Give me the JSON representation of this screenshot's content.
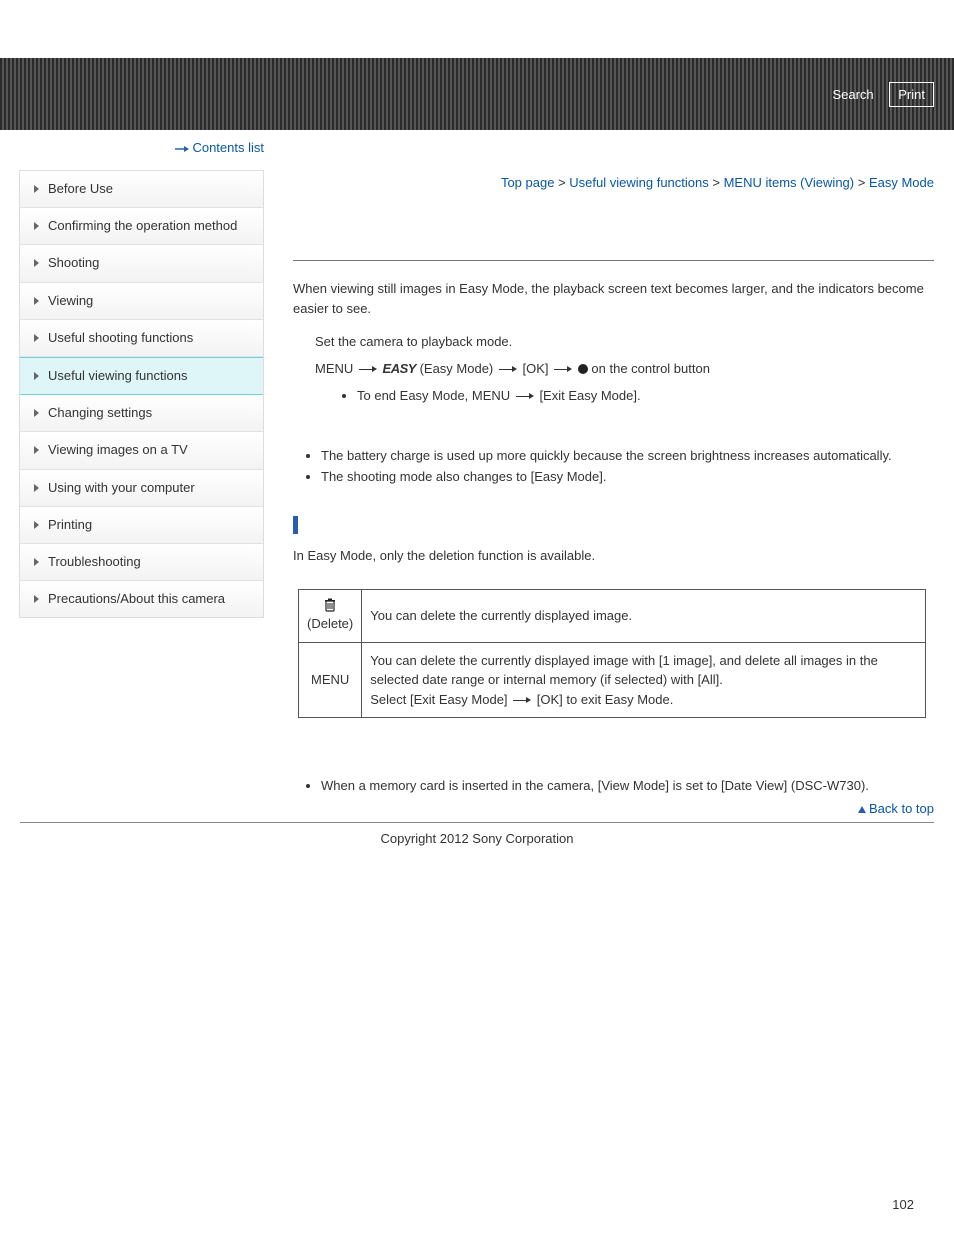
{
  "banner": {
    "search": "Search",
    "print": "Print"
  },
  "sidebar": {
    "items": [
      "Before Use",
      "Confirming the operation method",
      "Shooting",
      "Viewing",
      "Useful shooting functions",
      "Useful viewing functions",
      "Changing settings",
      "Viewing images on a TV",
      "Using with your computer",
      "Printing",
      "Troubleshooting",
      "Precautions/About this camera"
    ],
    "activeIndex": 5,
    "contentsList": "Contents list"
  },
  "breadcrumb": {
    "top": "Top page",
    "l1": "Useful viewing functions",
    "l2": "MENU items (Viewing)",
    "current": "Easy Mode",
    "sep": ">"
  },
  "content": {
    "intro": "When viewing still images in Easy Mode, the playback screen text becomes larger, and the indicators become easier to see.",
    "step1": "Set the camera to playback mode.",
    "step2_menu": "MENU",
    "step2_easy_icon": "EASY",
    "step2_easy_label": "(Easy Mode)",
    "step2_ok": "[OK]",
    "step2_control": "on the control button",
    "endEasy_pre": "To end Easy Mode, MENU",
    "endEasy_post": "[Exit Easy Mode].",
    "note1": "The battery charge is used up more quickly because the screen brightness increases automatically.",
    "note2": "The shooting mode also changes to [Easy Mode].",
    "sectionIntro": "In Easy Mode, only the deletion function is available.",
    "table": {
      "r1_label": "(Delete)",
      "r1_body": "You can delete the currently displayed image.",
      "r2_label": "MENU",
      "r2_body_l1": "You can delete the currently displayed image with [1 image], and delete all images in the selected date range or internal memory (if selected) with [All].",
      "r2_body_l2a": "Select [Exit Easy Mode]",
      "r2_body_l2b": "[OK] to exit Easy Mode."
    },
    "finalNote": "When a memory card is inserted in the camera, [View Mode] is set to [Date View] (DSC-W730).",
    "backTop": "Back to top",
    "copyright": "Copyright 2012 Sony Corporation",
    "pageNumber": "102"
  }
}
